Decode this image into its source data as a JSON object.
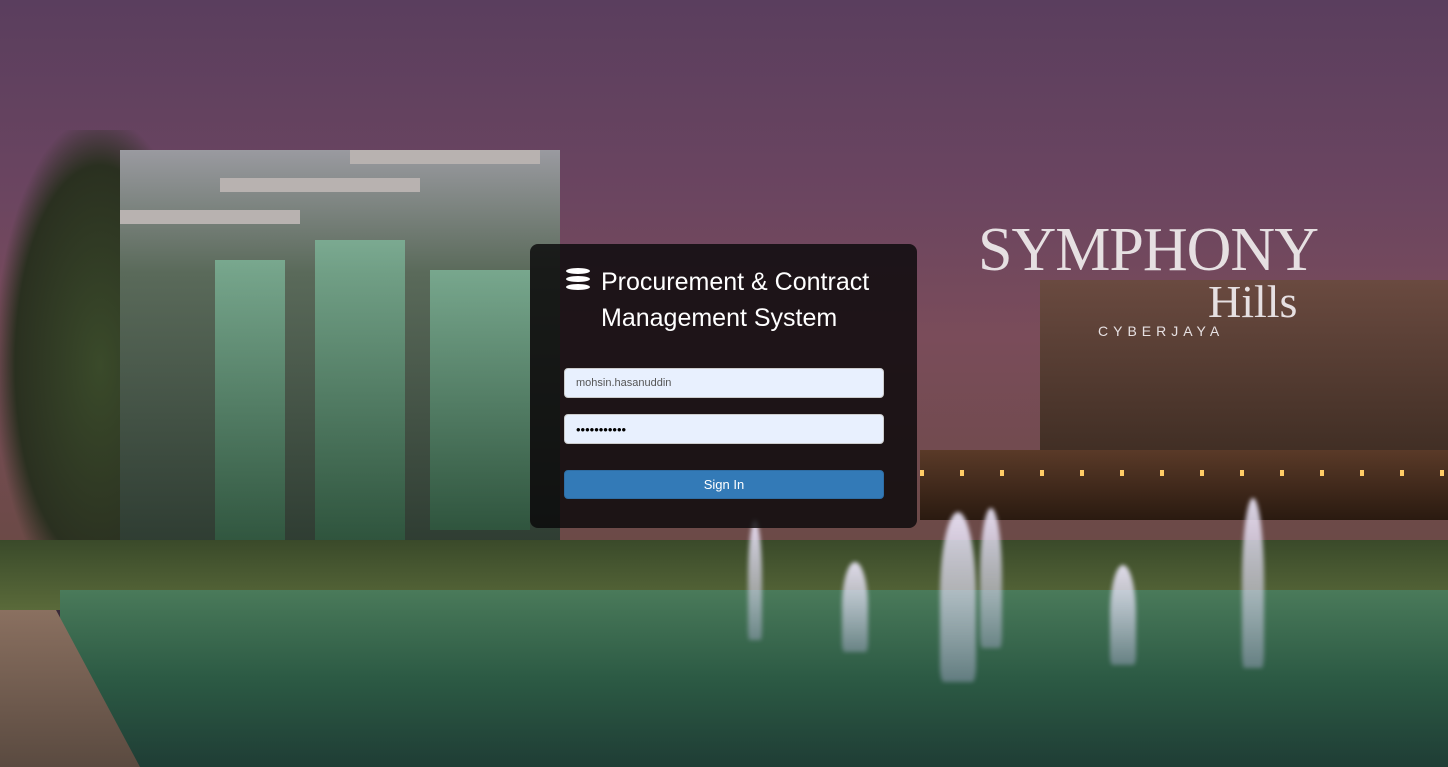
{
  "app": {
    "title_line1": "Procurement & Contract",
    "title_line2": "Management System",
    "icon": "database-icon"
  },
  "form": {
    "username_value": "mohsin.hasanuddin",
    "password_value": "password123",
    "sign_in_label": "Sign In"
  },
  "background": {
    "logo_main": "SYMPHONY",
    "logo_sub": "Hills",
    "logo_location": "CYBERJAYA",
    "primary_color": "#337ab7"
  }
}
